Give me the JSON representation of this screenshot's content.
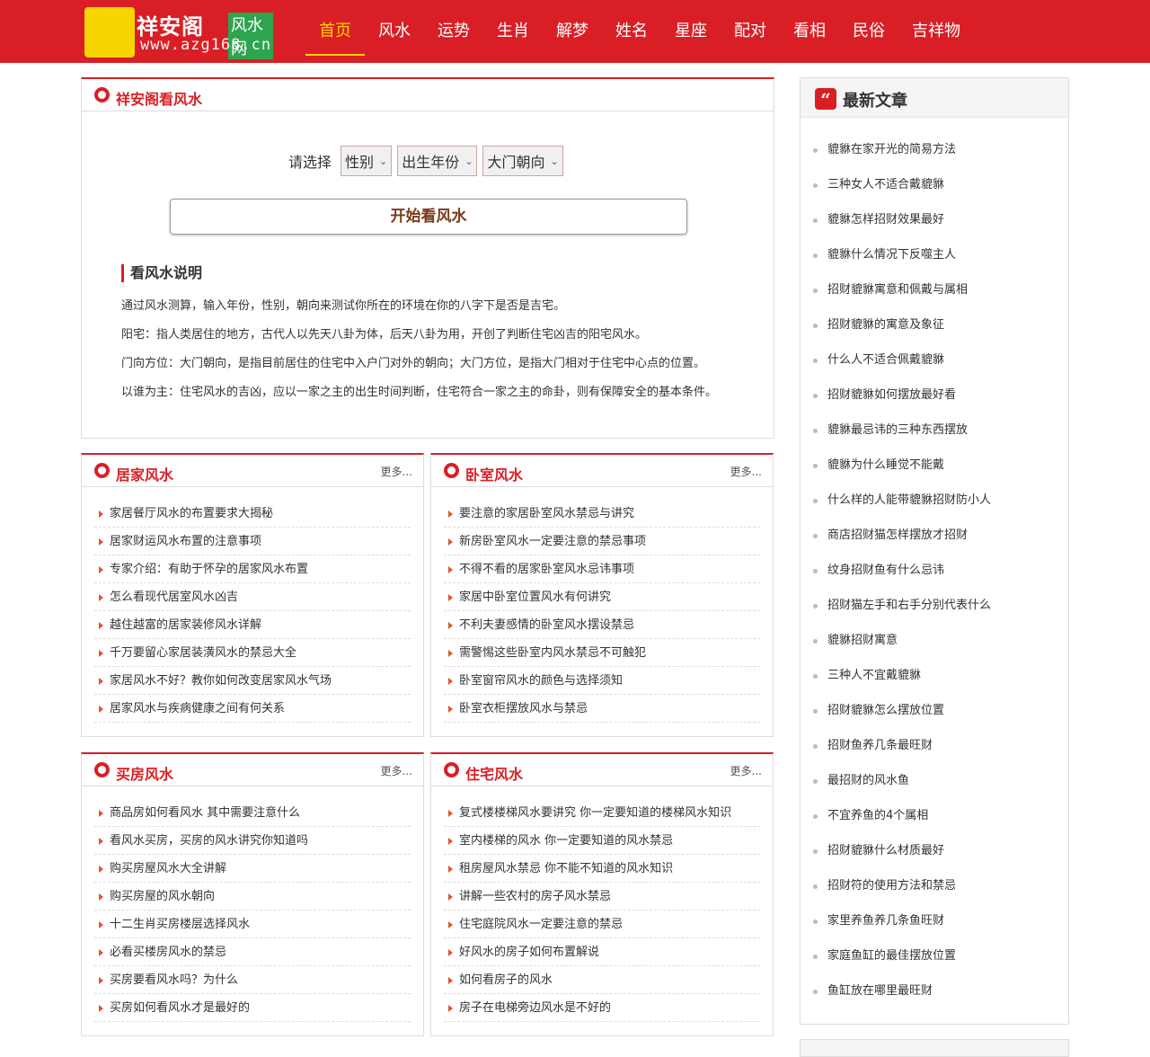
{
  "header": {
    "logo_text": "祥安阁",
    "logo_sub": "风水网",
    "logo_url": "www.azg168.cn",
    "nav": [
      "首页",
      "风水",
      "运势",
      "生肖",
      "解梦",
      "姓名",
      "星座",
      "配对",
      "看相",
      "民俗",
      "吉祥物"
    ],
    "active_index": 0
  },
  "fengshui_tool": {
    "title": "祥安阁看风水",
    "select_label": "请选择",
    "selects": [
      "性别",
      "出生年份",
      "大门朝向"
    ],
    "button": "开始看风水",
    "desc_title": "看风水说明",
    "desc": [
      "通过风水测算，输入年份，性别，朝向来测试你所在的环境在你的八字下是否是吉宅。",
      "阳宅：指人类居住的地方，古代人以先天八卦为体，后天八卦为用，开创了判断住宅凶吉的阳宅风水。",
      "门向方位：大门朝向，是指目前居住的住宅中入户门对外的朝向；大门方位，是指大门相对于住宅中心点的位置。",
      "以谁为主：住宅风水的吉凶，应以一家之主的出生时间判断，住宅符合一家之主的命卦，则有保障安全的基本条件。"
    ]
  },
  "more_label": "更多...",
  "sections": [
    {
      "title": "居家风水",
      "items": [
        "家居餐厅风水的布置要求大揭秘",
        "居家财运风水布置的注意事项",
        "专家介绍：有助于怀孕的居家风水布置",
        "怎么看现代居室风水凶吉",
        "越住越富的居家装修风水详解",
        "千万要留心家居装潢风水的禁忌大全",
        "家居风水不好？教你如何改变居家风水气场",
        "居家风水与疾病健康之间有何关系"
      ]
    },
    {
      "title": "卧室风水",
      "items": [
        "要注意的家居卧室风水禁忌与讲究",
        "新房卧室风水一定要注意的禁忌事项",
        "不得不看的居家卧室风水忌讳事项",
        "家居中卧室位置风水有何讲究",
        "不利夫妻感情的卧室风水摆设禁忌",
        "需警惕这些卧室内风水禁忌不可触犯",
        "卧室窗帘风水的颜色与选择须知",
        "卧室衣柜摆放风水与禁忌"
      ]
    },
    {
      "title": "买房风水",
      "items": [
        "商品房如何看风水 其中需要注意什么",
        "看风水买房，买房的风水讲究你知道吗",
        "购买房屋风水大全讲解",
        "购买房屋的风水朝向",
        "十二生肖买房楼层选择风水",
        "必看买楼房风水的禁忌",
        "买房要看风水吗？为什么",
        "买房如何看风水才是最好的"
      ]
    },
    {
      "title": "住宅风水",
      "items": [
        "复式楼楼梯风水要讲究 你一定要知道的楼梯风水知识",
        "室内楼梯的风水 你一定要知道的风水禁忌",
        "租房屋风水禁忌 你不能不知道的风水知识",
        "讲解一些农村的房子风水禁忌",
        "住宅庭院风水一定要注意的禁忌",
        "好风水的房子如何布置解说",
        "如何看房子的风水",
        "房子在电梯旁边风水是不好的"
      ]
    }
  ],
  "latest": {
    "icon": "quote-icon",
    "title": "最新文章",
    "items": [
      "貔貅在家开光的简易方法",
      "三种女人不适合戴貔貅",
      "貔貅怎样招财效果最好",
      "貔貅什么情况下反噬主人",
      "招财貔貅寓意和佩戴与属相",
      "招财貔貅的寓意及象征",
      "什么人不适合佩戴貔貅",
      "招财貔貅如何摆放最好看",
      "貔貅最忌讳的三种东西摆放",
      "貔貅为什么睡觉不能戴",
      "什么样的人能带貔貅招财防小人",
      "商店招财猫怎样摆放才招财",
      "纹身招财鱼有什么忌讳",
      "招财猫左手和右手分别代表什么",
      "貔貅招财寓意",
      "三种人不宜戴貔貅",
      "招财貔貅怎么摆放位置",
      "招财鱼养几条最旺财",
      "最招财的风水鱼",
      "不宜养鱼的4个属相",
      "招财貔貅什么材质最好",
      "招财符的使用方法和禁忌",
      "家里养鱼养几条鱼旺财",
      "家庭鱼缸的最佳摆放位置",
      "鱼缸放在哪里最旺财"
    ]
  },
  "colors": {
    "brand_red": "#d91f25",
    "nav_active": "#ffd200",
    "logo_yellow": "#f6d500"
  }
}
